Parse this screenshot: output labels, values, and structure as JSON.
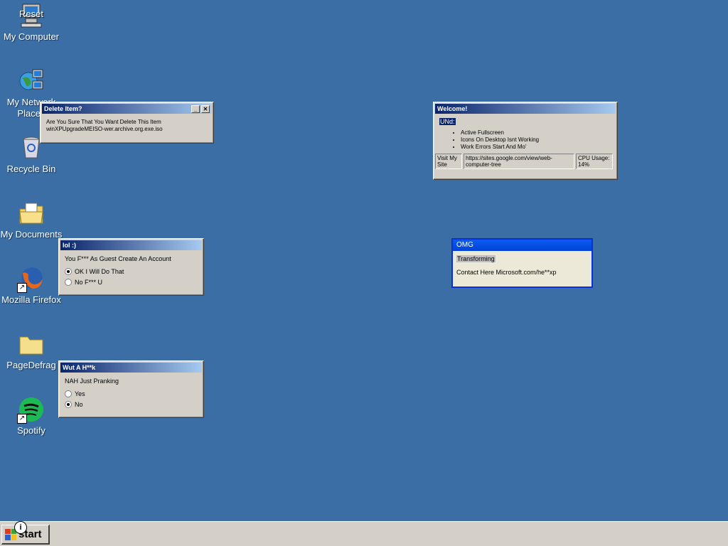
{
  "desktop_icons": [
    {
      "label": "My Computer",
      "overlay": "Reset",
      "icon": "computer-icon"
    },
    {
      "label": "My Network Places",
      "icon": "network-icon"
    },
    {
      "label": "Recycle Bin",
      "icon": "recycle-bin-icon"
    },
    {
      "label": "My Documents",
      "icon": "documents-folder-icon"
    },
    {
      "label": "Mozilla Firefox",
      "icon": "firefox-icon"
    },
    {
      "label": "PageDefrag",
      "icon": "folder-icon"
    },
    {
      "label": "Spotify",
      "icon": "spotify-icon"
    }
  ],
  "delete_dialog": {
    "title": "Delete Item?",
    "line1": "Are You Sure That You Want Delete This Item",
    "line2": "winXPUpgradeMEISO-wer.archive.org.exe.iso"
  },
  "lol_dialog": {
    "title": "lol :)",
    "message": "You F*** As Guest Create An Account",
    "options": [
      "OK I Will Do That",
      "No F*** U"
    ],
    "selected": 0
  },
  "wut_dialog": {
    "title": "Wut A H**k",
    "message": "NAH Just Pranking",
    "options": [
      "Yes",
      "No"
    ],
    "selected": 1
  },
  "welcome_window": {
    "title": "Welcome!",
    "heading": "UNd:",
    "items": [
      "Active Fullscreen",
      "Icons On Desktop Isnt Working",
      "Work Errors Start And Mo'"
    ],
    "status": {
      "visit": "Visit My Site",
      "url": "https://sites.google.com/view/web-computer-tree",
      "cpu": "CPU Usage: 14%"
    }
  },
  "omg_window": {
    "title": "OMG",
    "line1": "Transforming",
    "line2": "Contact Here Microsoft.com/he**xp"
  },
  "taskbar": {
    "start_label": "start",
    "info_glyph": "i"
  },
  "colors": {
    "desktop": "#3a6ea5",
    "title_active": "#0a246a",
    "face": "#d4d0c8"
  }
}
